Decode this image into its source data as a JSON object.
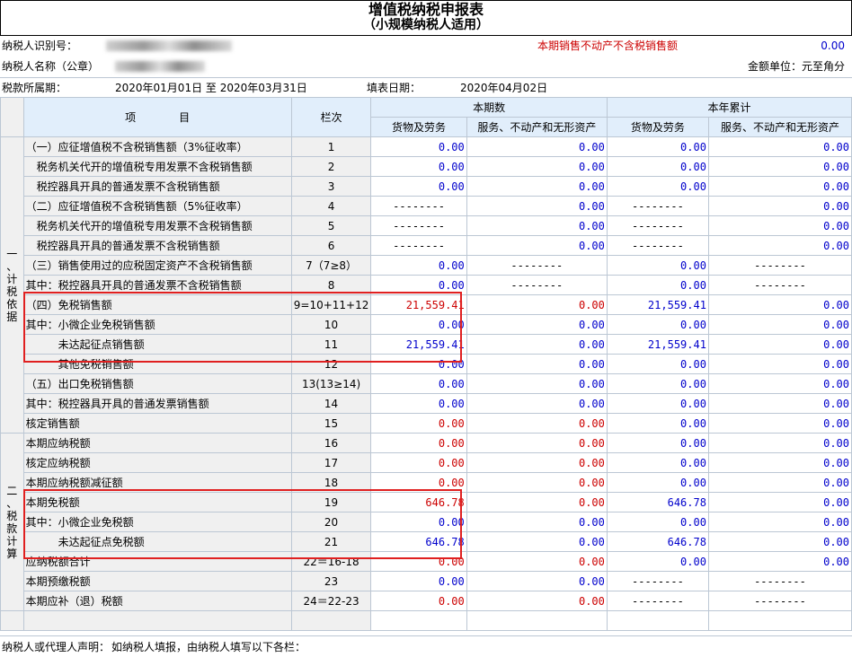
{
  "header": {
    "title": "增值税纳税申报表",
    "subtitle": "（小规模纳税人适用）"
  },
  "info": {
    "taxpayer_id_label": "纳税人识别号：",
    "taxpayer_name_label": "纳税人名称（公章）",
    "realestate_label": "本期销售不动产不含税销售额",
    "realestate_value": "0.00",
    "unit_label": "金额单位：元至角分",
    "period_label": "税款所属期：",
    "period_value": "2020年01月01日 至 2020年03月31日",
    "fill_date_label": "填表日期：",
    "fill_date_value": "2020年04月02日"
  },
  "table_headers": {
    "item": "项　　　　目",
    "col_no": "栏次",
    "current": "本期数",
    "ytd": "本年累计",
    "goods": "货物及劳务",
    "services": "服务、不动产和无形资产"
  },
  "sections": {
    "basis": "一、计税依据",
    "calc": "二、税款计算"
  },
  "rows": [
    {
      "label": "（一）应征增值税不含税销售额（3%征收率）",
      "no": "1",
      "c1": "0.00",
      "c2": "0.00",
      "c3": "0.00",
      "c4": "0.00",
      "colors": [
        "blue",
        "blue",
        "blue",
        "blue"
      ]
    },
    {
      "label": "　税务机关代开的增值税专用发票不含税销售额",
      "no": "2",
      "c1": "0.00",
      "c2": "0.00",
      "c3": "0.00",
      "c4": "0.00",
      "colors": [
        "blue",
        "blue",
        "blue",
        "blue"
      ]
    },
    {
      "label": "　税控器具开具的普通发票不含税销售额",
      "no": "3",
      "c1": "0.00",
      "c2": "0.00",
      "c3": "0.00",
      "c4": "0.00",
      "colors": [
        "blue",
        "blue",
        "blue",
        "blue"
      ]
    },
    {
      "label": "（二）应征增值税不含税销售额（5%征收率）",
      "no": "4",
      "c1": "--------",
      "c2": "0.00",
      "c3": "--------",
      "c4": "0.00",
      "colors": [
        "dash",
        "blue",
        "dash",
        "blue"
      ]
    },
    {
      "label": "　税务机关代开的增值税专用发票不含税销售额",
      "no": "5",
      "c1": "--------",
      "c2": "0.00",
      "c3": "--------",
      "c4": "0.00",
      "colors": [
        "dash",
        "blue",
        "dash",
        "blue"
      ]
    },
    {
      "label": "　税控器具开具的普通发票不含税销售额",
      "no": "6",
      "c1": "--------",
      "c2": "0.00",
      "c3": "--------",
      "c4": "0.00",
      "colors": [
        "dash",
        "blue",
        "dash",
        "blue"
      ]
    },
    {
      "label": "（三）销售使用过的应税固定资产不含税销售额",
      "no": "7（7≥8）",
      "c1": "0.00",
      "c2": "--------",
      "c3": "0.00",
      "c4": "--------",
      "colors": [
        "blue",
        "dash",
        "blue",
        "dash"
      ]
    },
    {
      "label": "其中：税控器具开具的普通发票不含税销售额",
      "no": "8",
      "c1": "0.00",
      "c2": "--------",
      "c3": "0.00",
      "c4": "--------",
      "colors": [
        "blue",
        "dash",
        "blue",
        "dash"
      ]
    },
    {
      "label": "（四）免税销售额",
      "no": "9=10+11+12",
      "c1": "21,559.41",
      "c2": "0.00",
      "c3": "21,559.41",
      "c4": "0.00",
      "colors": [
        "red",
        "red",
        "blue",
        "blue"
      ]
    },
    {
      "label": "其中：小微企业免税销售额",
      "no": "10",
      "c1": "0.00",
      "c2": "0.00",
      "c3": "0.00",
      "c4": "0.00",
      "colors": [
        "blue",
        "blue",
        "blue",
        "blue"
      ]
    },
    {
      "label": "　　　未达起征点销售额",
      "no": "11",
      "c1": "21,559.41",
      "c2": "0.00",
      "c3": "21,559.41",
      "c4": "0.00",
      "colors": [
        "blue",
        "blue",
        "blue",
        "blue"
      ]
    },
    {
      "label": "　　　其他免税销售额",
      "no": "12",
      "c1": "0.00",
      "c2": "0.00",
      "c3": "0.00",
      "c4": "0.00",
      "colors": [
        "blue",
        "blue",
        "blue",
        "blue"
      ]
    },
    {
      "label": "（五）出口免税销售额",
      "no": "13(13≥14)",
      "c1": "0.00",
      "c2": "0.00",
      "c3": "0.00",
      "c4": "0.00",
      "colors": [
        "blue",
        "blue",
        "blue",
        "blue"
      ]
    },
    {
      "label": "其中：税控器具开具的普通发票销售额",
      "no": "14",
      "c1": "0.00",
      "c2": "0.00",
      "c3": "0.00",
      "c4": "0.00",
      "colors": [
        "blue",
        "blue",
        "blue",
        "blue"
      ]
    },
    {
      "label": "核定销售额",
      "no": "15",
      "c1": "0.00",
      "c2": "0.00",
      "c3": "0.00",
      "c4": "0.00",
      "colors": [
        "red",
        "red",
        "blue",
        "blue"
      ]
    },
    {
      "label": "本期应纳税额",
      "no": "16",
      "c1": "0.00",
      "c2": "0.00",
      "c3": "0.00",
      "c4": "0.00",
      "colors": [
        "red",
        "red",
        "blue",
        "blue"
      ]
    },
    {
      "label": "核定应纳税额",
      "no": "17",
      "c1": "0.00",
      "c2": "0.00",
      "c3": "0.00",
      "c4": "0.00",
      "colors": [
        "red",
        "red",
        "blue",
        "blue"
      ]
    },
    {
      "label": "本期应纳税额减征额",
      "no": "18",
      "c1": "0.00",
      "c2": "0.00",
      "c3": "0.00",
      "c4": "0.00",
      "colors": [
        "red",
        "red",
        "blue",
        "blue"
      ]
    },
    {
      "label": "本期免税额",
      "no": "19",
      "c1": "646.78",
      "c2": "0.00",
      "c3": "646.78",
      "c4": "0.00",
      "colors": [
        "red",
        "red",
        "blue",
        "blue"
      ]
    },
    {
      "label": "其中：小微企业免税额",
      "no": "20",
      "c1": "0.00",
      "c2": "0.00",
      "c3": "0.00",
      "c4": "0.00",
      "colors": [
        "blue",
        "blue",
        "blue",
        "blue"
      ]
    },
    {
      "label": "　　　未达起征点免税额",
      "no": "21",
      "c1": "646.78",
      "c2": "0.00",
      "c3": "646.78",
      "c4": "0.00",
      "colors": [
        "blue",
        "blue",
        "blue",
        "blue"
      ]
    },
    {
      "label": "应纳税额合计",
      "no": "22＝16-18",
      "c1": "0.00",
      "c2": "0.00",
      "c3": "0.00",
      "c4": "0.00",
      "colors": [
        "red",
        "red",
        "blue",
        "blue"
      ]
    },
    {
      "label": "本期预缴税额",
      "no": "23",
      "c1": "0.00",
      "c2": "0.00",
      "c3": "--------",
      "c4": "--------",
      "colors": [
        "blue",
        "blue",
        "dash",
        "dash"
      ]
    },
    {
      "label": "本期应补（退）税额",
      "no": "24＝22-23",
      "c1": "0.00",
      "c2": "0.00",
      "c3": "--------",
      "c4": "--------",
      "colors": [
        "red",
        "red",
        "dash",
        "dash"
      ]
    }
  ],
  "footer": {
    "declarant_label": "纳税人或代理人声明：",
    "declarant_text": "如纳税人填报，由纳税人填写以下各栏："
  }
}
